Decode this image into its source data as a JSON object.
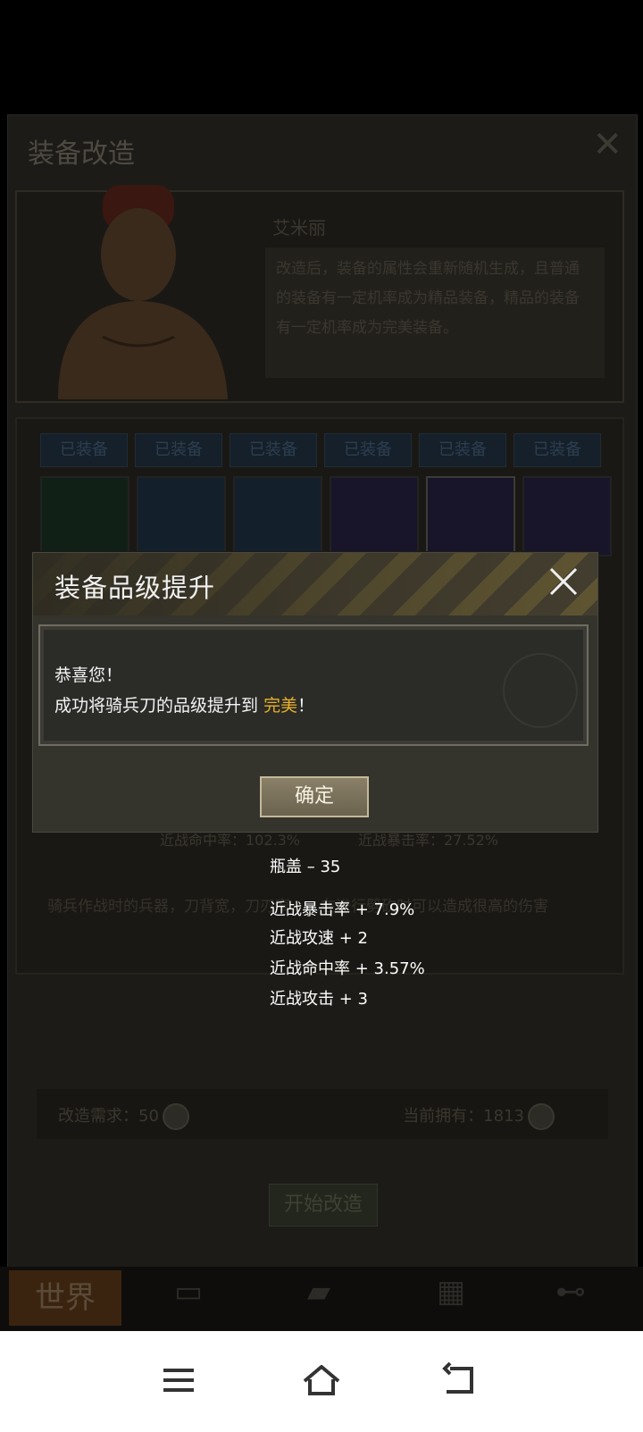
{
  "background": {
    "title": "装备改造",
    "npc_name": "艾米丽",
    "npc_desc": "改造后，装备的属性会重新随机生成，且普通的装备有一定机率成为精品装备，精品的装备有一定机率成为完美装备。",
    "slot_tags": [
      "已装备",
      "已装备",
      "已装备",
      "已装备",
      "已装备",
      "已装备"
    ],
    "stat_left": "近战命中率：102.3%",
    "stat_right": "近战暴击率：27.52%",
    "item_desc": "骑兵作战时的兵器，刀背宽，刀刃窄，…在进行劈砍时可以造成很高的伤害",
    "requirement": "改造需求：50",
    "owned": "当前拥有：1813",
    "start_button": "开始改造",
    "tab_world": "世界"
  },
  "modal": {
    "title": "装备品级提升",
    "line1": "恭喜您！",
    "line2_prefix": "成功将骑兵刀的品级提升到",
    "line2_highlight": "完美",
    "line2_suffix": "！",
    "ok_button": "确定"
  },
  "rewards": [
    "瓶盖 – 35",
    "近战暴击率 + 7.9%",
    "近战攻速 + 2",
    "近战命中率 + 3.57%",
    "近战攻击 + 3"
  ],
  "colors": {
    "highlight": "#e7b12a",
    "modal_bg": "#34332c",
    "hazard_yellow": "#6b5f36"
  }
}
